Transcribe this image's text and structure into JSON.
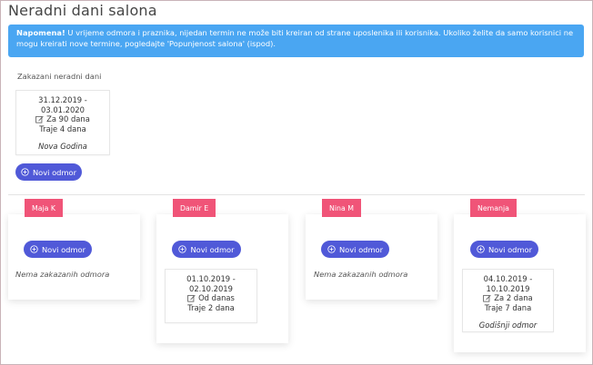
{
  "page": {
    "title": "Neradni dani salona"
  },
  "notice": {
    "label": "Napomena!",
    "text": " U vrijeme odmora i praznika, nijedan termin ne može biti kreiran od strane uposlenika ili korisnika. Ukoliko želite da samo korisnici ne mogu kreirati nove termine, pogledajte 'Popunjenost salona' (ispod)."
  },
  "salon": {
    "section_label": "Zakazani neradni dani",
    "holidays": [
      {
        "range": "31.12.2019 - 03.01.2020",
        "countdown": "Za 90 dana",
        "duration": "Traje 4 dana",
        "name": "Nova Godina"
      }
    ],
    "add_button": "Novi odmor"
  },
  "employees": [
    {
      "name": "Maja K",
      "add_button": "Novi odmor",
      "empty_text": "Nema zakazanih odmora",
      "vacations": []
    },
    {
      "name": "Damir E",
      "add_button": "Novi odmor",
      "empty_text": "",
      "vacations": [
        {
          "range": "01.10.2019 - 02.10.2019",
          "countdown": "Od danas",
          "duration": "Traje 2 dana",
          "name": ""
        }
      ]
    },
    {
      "name": "Nina M",
      "add_button": "Novi odmor",
      "empty_text": "Nema zakazanih odmora",
      "vacations": []
    },
    {
      "name": "Nemanja",
      "add_button": "Novi odmor",
      "empty_text": "",
      "vacations": [
        {
          "range": "04.10.2019 - 10.10.2019",
          "countdown": "Za 2 dana",
          "duration": "Traje 7 dana",
          "name": "Godišnji odmor"
        }
      ]
    }
  ],
  "icons": {
    "edit": "edit-icon",
    "add": "plus-circle-icon"
  },
  "colors": {
    "primary_button": "#5059d8",
    "badge": "#f05478",
    "notice": "#4aa6f2"
  }
}
